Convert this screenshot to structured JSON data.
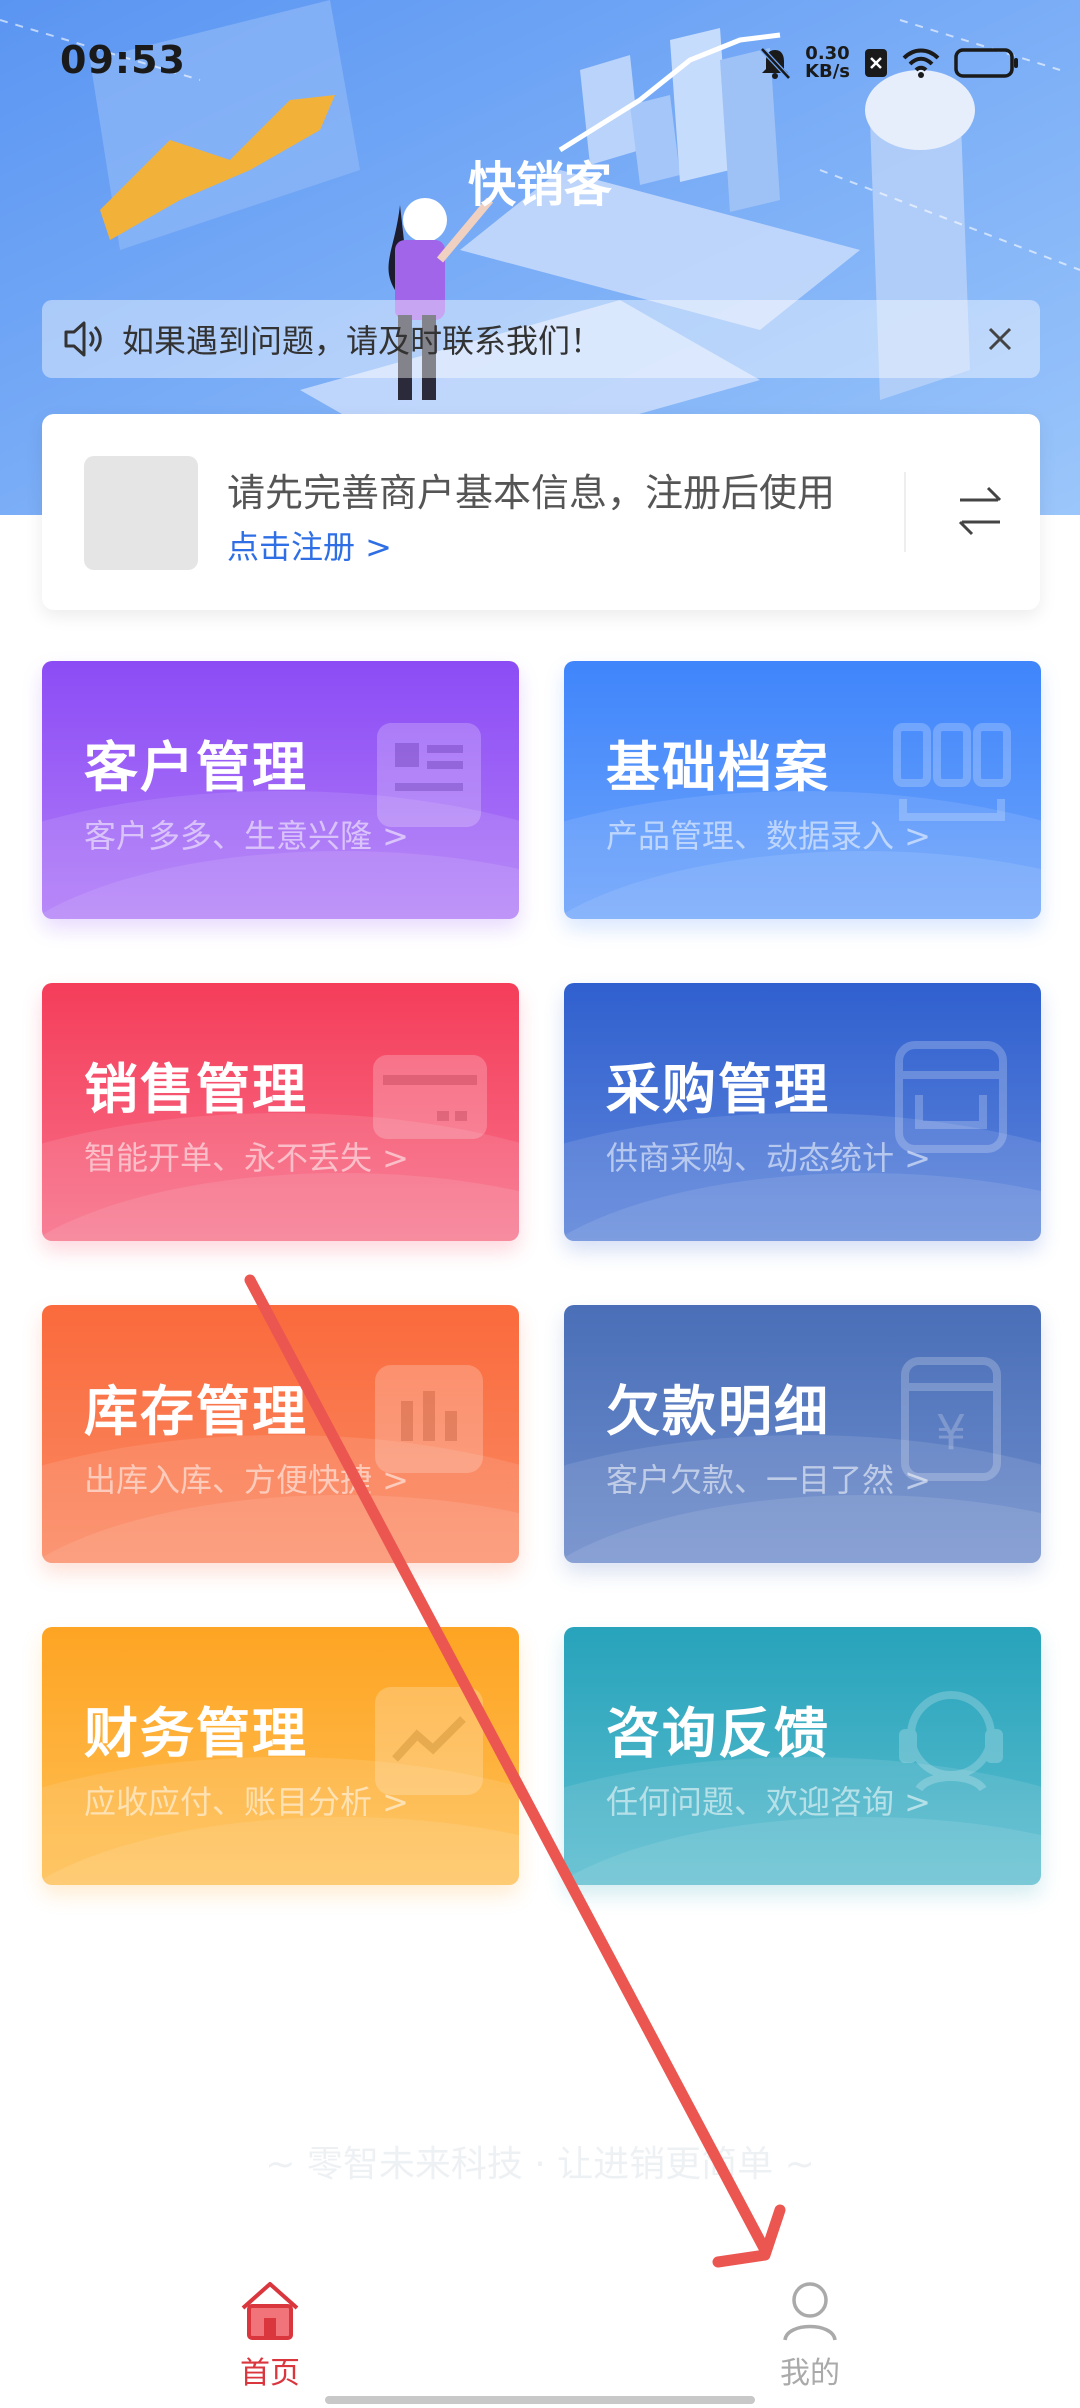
{
  "status_bar": {
    "time": "09:53",
    "net_speed_value": "0.30",
    "net_speed_unit": "KB/s",
    "icons": [
      "mute-bell-icon",
      "network-speed",
      "sim-x-icon",
      "wifi-icon",
      "battery-icon"
    ]
  },
  "header": {
    "title": "快销客"
  },
  "notice": {
    "text": "如果遇到问题，请及时联系我们！",
    "icon": "speaker-icon",
    "close_icon": "close-icon"
  },
  "merchant": {
    "message": "请先完善商户基本信息，注册后使用",
    "link": "点击注册 >",
    "switch_icon": "switch-arrows-icon"
  },
  "cards": [
    {
      "title": "客户管理",
      "subtitle": "客户多多、生意兴隆 >",
      "color_from": "#8c4cf5",
      "color_to": "#b07cf8",
      "icon": "customer-card-icon"
    },
    {
      "title": "基础档案",
      "subtitle": "产品管理、数据录入 >",
      "color_from": "#3f85fb",
      "color_to": "#6ea4fb",
      "icon": "archive-icon"
    },
    {
      "title": "销售管理",
      "subtitle": "智能开单、永不丢失 >",
      "color_from": "#f53d5a",
      "color_to": "#f6718a",
      "icon": "sales-card-icon"
    },
    {
      "title": "采购管理",
      "subtitle": "供商采购、动态统计 >",
      "color_from": "#3060cf",
      "color_to": "#5f86da",
      "icon": "purchase-box-icon"
    },
    {
      "title": "库存管理",
      "subtitle": "出库入库、方便快捷 >",
      "color_from": "#fa6a3c",
      "color_to": "#fb8a64",
      "icon": "inventory-chart-icon"
    },
    {
      "title": "欠款明细",
      "subtitle": "客户欠款、一目了然 >",
      "color_from": "#4a6fb8",
      "color_to": "#6e8ccb",
      "icon": "yen-receipt-icon"
    },
    {
      "title": "财务管理",
      "subtitle": "应收应付、账目分析 >",
      "color_from": "#fea423",
      "color_to": "#fec055",
      "icon": "finance-trend-icon"
    },
    {
      "title": "咨询反馈",
      "subtitle": "任何问题、欢迎咨询 >",
      "color_from": "#27a3bb",
      "color_to": "#5cbdcf",
      "icon": "headset-icon"
    }
  ],
  "footer": {
    "slogan": "~ 零智未来科技 · 让进销更简单 ~"
  },
  "tabbar": {
    "home": {
      "label": "首页",
      "icon": "home-icon",
      "color": "#d9363e"
    },
    "mine": {
      "label": "我的",
      "icon": "user-icon",
      "color": "#aaaaaa"
    }
  }
}
